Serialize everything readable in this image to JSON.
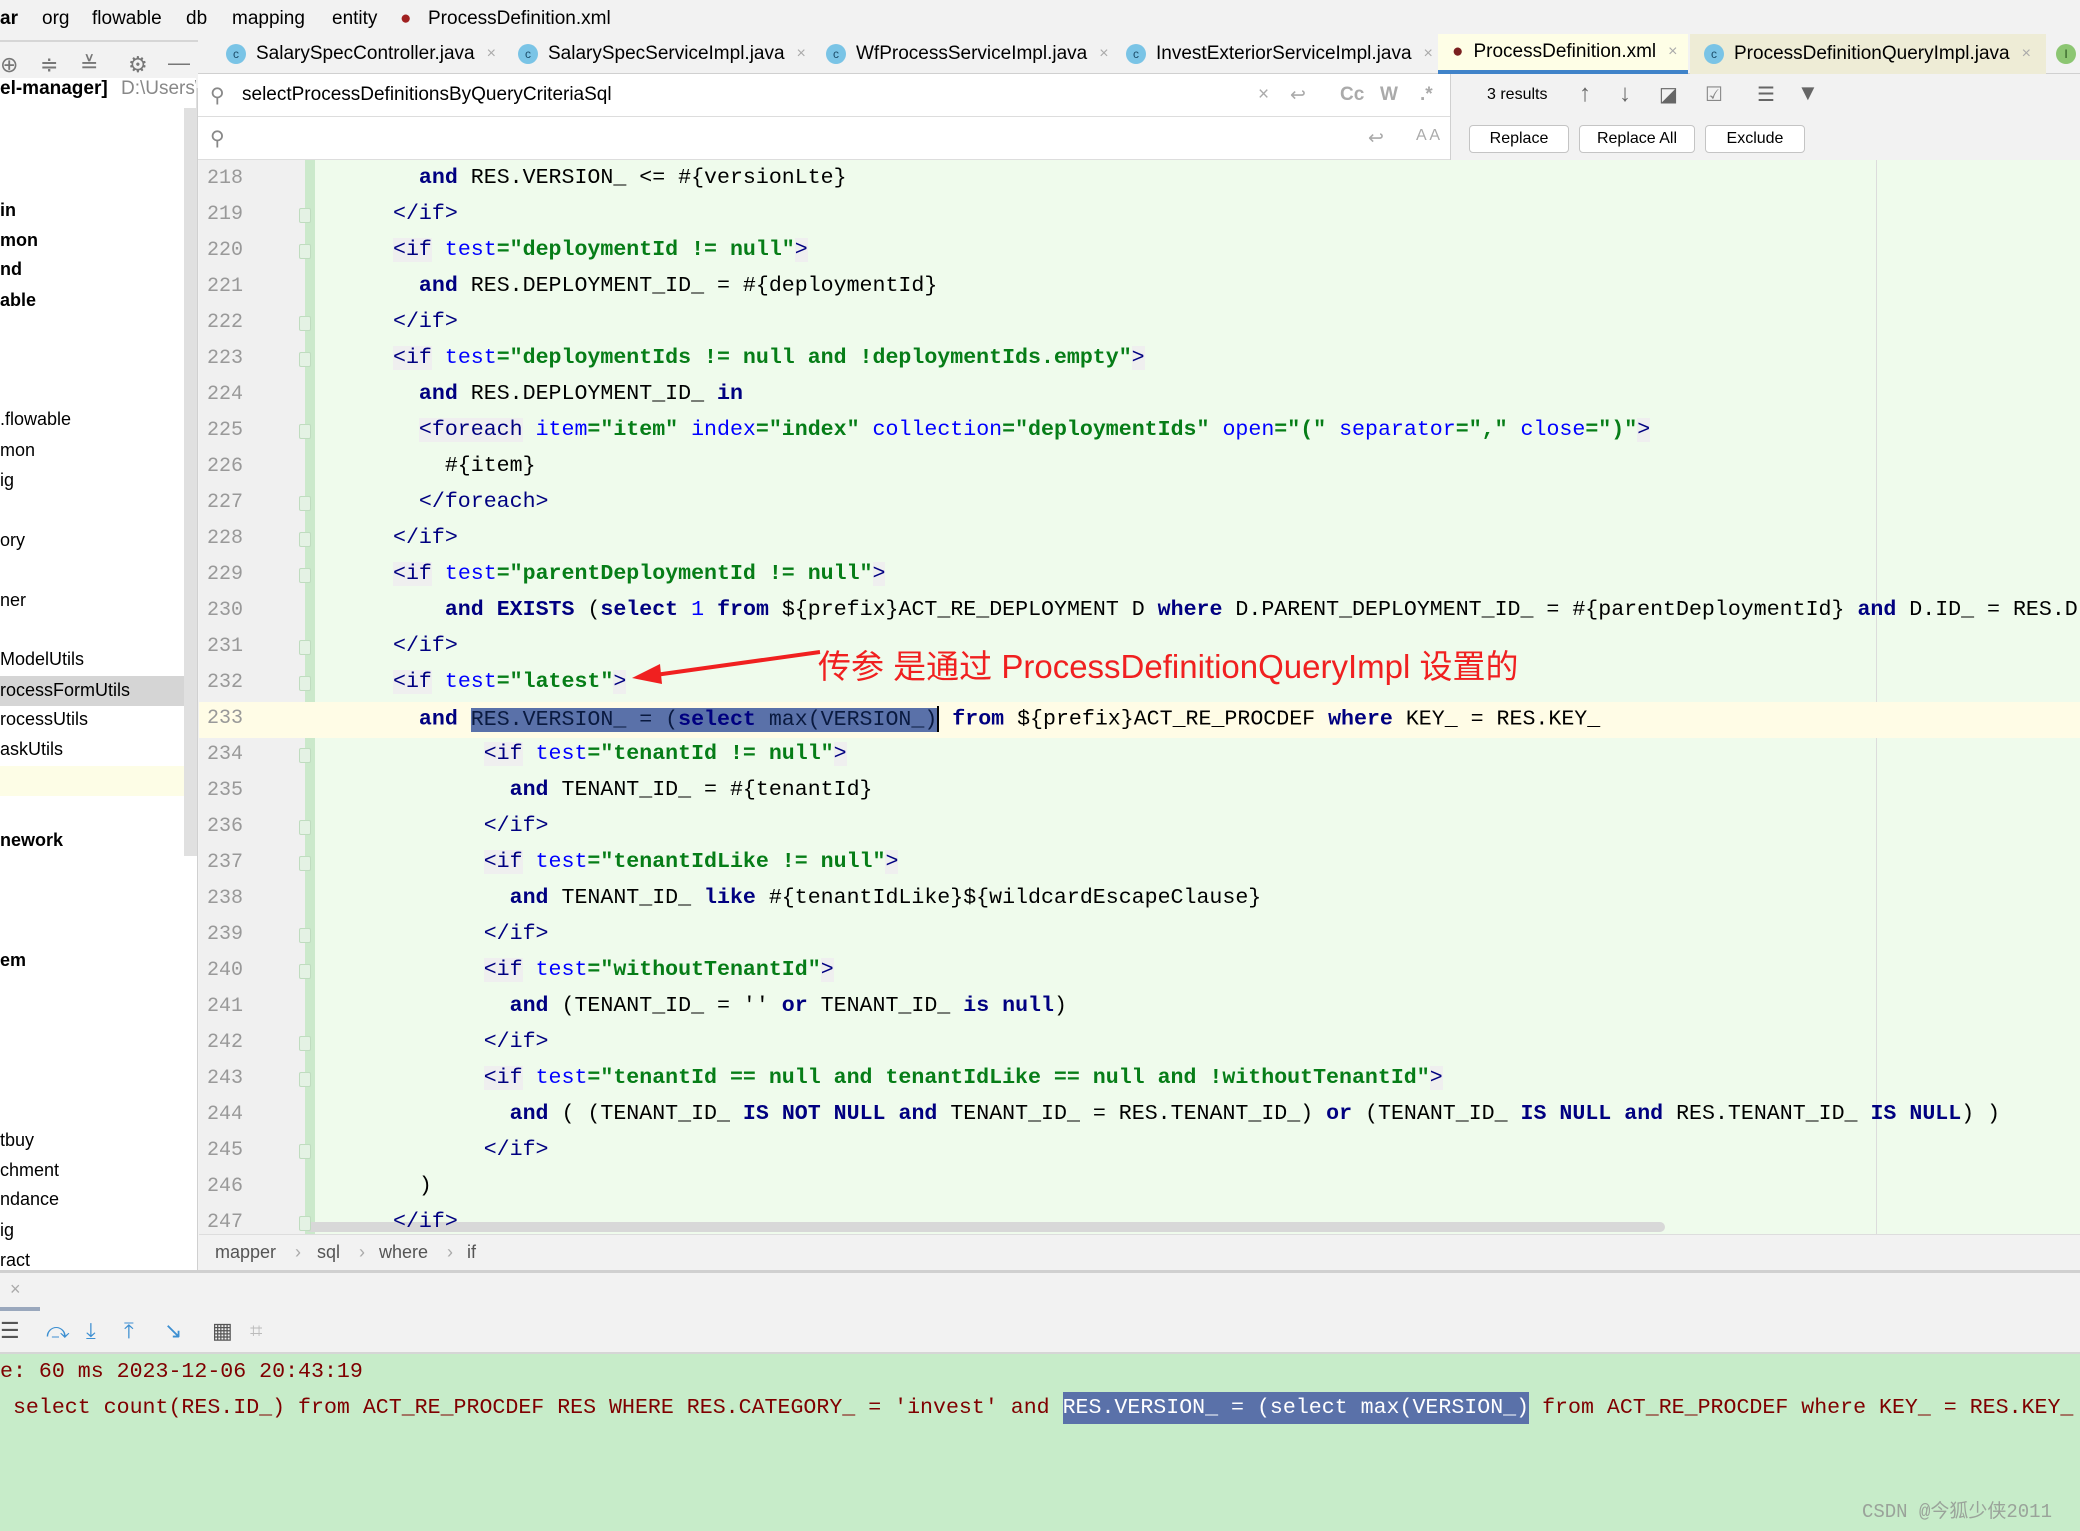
{
  "breadcrumb": [
    "ar",
    "org",
    "flowable",
    "db",
    "mapping",
    "entity",
    "ProcessDefinition.xml"
  ],
  "project": {
    "root_label": "el-manager]",
    "root_path": "D:\\Users\\",
    "items": [
      {
        "label": "in",
        "bold": true
      },
      {
        "label": "mon",
        "bold": true
      },
      {
        "label": "nd",
        "bold": true
      },
      {
        "label": "able",
        "bold": true
      },
      {
        "label": ".flowable"
      },
      {
        "label": "mon"
      },
      {
        "label": "ig"
      },
      {
        "label": "ory"
      },
      {
        "label": "ner"
      },
      {
        "label": "ModelUtils"
      },
      {
        "label": "rocessFormUtils",
        "selected": true
      },
      {
        "label": "rocessUtils"
      },
      {
        "label": "askUtils"
      },
      {
        "label": "",
        "highlight": true
      },
      {
        "label": "nework",
        "bold": true
      },
      {
        "label": "em",
        "bold": true
      },
      {
        "label": "tbuy"
      },
      {
        "label": "chment"
      },
      {
        "label": "ndance"
      },
      {
        "label": "ig"
      },
      {
        "label": "ract"
      }
    ]
  },
  "tabs": [
    {
      "label": "SalarySpecController.java",
      "icon": "class-icon"
    },
    {
      "label": "SalarySpecServiceImpl.java",
      "icon": "class-icon"
    },
    {
      "label": "WfProcessServiceImpl.java",
      "icon": "class-icon"
    },
    {
      "label": "InvestExteriorServiceImpl.java",
      "icon": "class-icon"
    },
    {
      "label": "ProcessDefinition.xml",
      "icon": "mybatis-icon",
      "active": true
    },
    {
      "label": "ProcessDefinitionQueryImpl.java",
      "icon": "class-icon"
    }
  ],
  "search": {
    "find_value": "selectProcessDefinitionsByQueryCriteriaSql",
    "replace_value": "",
    "results": "3 results",
    "match_case": "Cc",
    "words": "W",
    "regex": ".*",
    "preserve_case": "A A",
    "replace": "Replace",
    "replace_all": "Replace All",
    "exclude": "Exclude"
  },
  "editor": {
    "current_line": 233,
    "lines": [
      {
        "n": 218,
        "text": "  and RES.VERSION_ <= #{versionLte}"
      },
      {
        "n": 219,
        "text": "</if>"
      },
      {
        "n": 220,
        "text": "<if test=\"deploymentId != null\">"
      },
      {
        "n": 221,
        "text": "  and RES.DEPLOYMENT_ID_ = #{deploymentId}"
      },
      {
        "n": 222,
        "text": "</if>"
      },
      {
        "n": 223,
        "text": "<if test=\"deploymentIds != null and !deploymentIds.empty\">"
      },
      {
        "n": 224,
        "text": "  and RES.DEPLOYMENT_ID_ in"
      },
      {
        "n": 225,
        "text": "  <foreach item=\"item\" index=\"index\" collection=\"deploymentIds\" open=\"(\" separator=\",\" close=\")\">"
      },
      {
        "n": 226,
        "text": "    #{item}"
      },
      {
        "n": 227,
        "text": "  </foreach>"
      },
      {
        "n": 228,
        "text": "</if>"
      },
      {
        "n": 229,
        "text": "<if test=\"parentDeploymentId != null\">"
      },
      {
        "n": 230,
        "text": "    and EXISTS (select 1 from ${prefix}ACT_RE_DEPLOYMENT D where D.PARENT_DEPLOYMENT_ID_ = #{parentDeploymentId} and D.ID_ = RES.D"
      },
      {
        "n": 231,
        "text": "</if>"
      },
      {
        "n": 232,
        "text": "<if test=\"latest\">"
      },
      {
        "n": 233,
        "text": "  and ",
        "selection": "RES.VERSION_ = (select max(VERSION_)",
        "after": " from ${prefix}ACT_RE_PROCDEF where KEY_ = RES.KEY_"
      },
      {
        "n": 234,
        "text": "       <if test=\"tenantId != null\">"
      },
      {
        "n": 235,
        "text": "         and TENANT_ID_ = #{tenantId}"
      },
      {
        "n": 236,
        "text": "       </if>"
      },
      {
        "n": 237,
        "text": "       <if test=\"tenantIdLike != null\">"
      },
      {
        "n": 238,
        "text": "         and TENANT_ID_ like #{tenantIdLike}${wildcardEscapeClause}"
      },
      {
        "n": 239,
        "text": "       </if>"
      },
      {
        "n": 240,
        "text": "       <if test=\"withoutTenantId\">"
      },
      {
        "n": 241,
        "text": "         and (TENANT_ID_ = '' or TENANT_ID_ is null)"
      },
      {
        "n": 242,
        "text": "       </if>"
      },
      {
        "n": 243,
        "text": "       <if test=\"tenantId == null and tenantIdLike == null and !withoutTenantId\">"
      },
      {
        "n": 244,
        "text": "         and ( (TENANT_ID_ IS NOT NULL and TENANT_ID_ = RES.TENANT_ID_) or (TENANT_ID_ IS NULL and RES.TENANT_ID_ IS NULL) )"
      },
      {
        "n": 245,
        "text": "       </if>"
      },
      {
        "n": 246,
        "text": "  )"
      },
      {
        "n": 247,
        "text": "</if>"
      }
    ]
  },
  "annotation": {
    "text": "传参 是通过 ProcessDefinitionQueryImpl 设置的",
    "color": "#f02020"
  },
  "path_breadcrumb": [
    "mapper",
    "sql",
    "where",
    "if"
  ],
  "console": {
    "line1": "e: 60 ms 2023-12-06 20:43:19",
    "line2_before": " select count(RES.ID_) from ACT_RE_PROCDEF RES WHERE RES.CATEGORY_ = 'invest' and ",
    "line2_selection": "RES.VERSION_ = (select max(VERSION_)",
    "line2_after": " from ACT_RE_PROCDEF where KEY_ = RES.KEY_"
  },
  "watermark": "CSDN @今狐少侠2011",
  "colors": {
    "editor_bg": "#effbec",
    "console_bg": "#c7ecc9",
    "selection": "#5a71a9",
    "active_tab_underline": "#4083c9"
  }
}
